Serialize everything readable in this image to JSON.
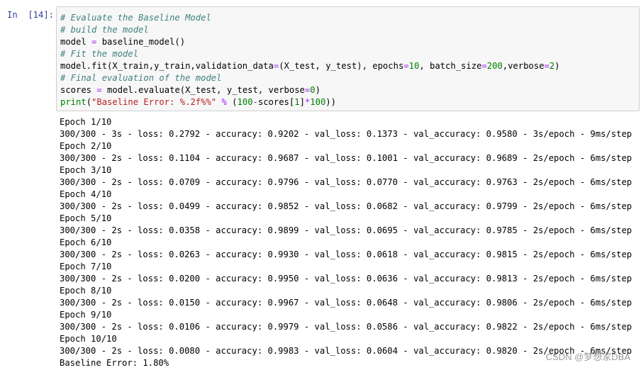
{
  "cell": {
    "prompt": "In  [14]:",
    "code_lines": [
      [
        {
          "t": "comment",
          "v": "# Evaluate the Baseline Model"
        }
      ],
      [
        {
          "t": "comment",
          "v": "# build the model"
        }
      ],
      [
        {
          "t": "plain",
          "v": "model "
        },
        {
          "t": "op",
          "v": "="
        },
        {
          "t": "plain",
          "v": " baseline_model()"
        }
      ],
      [
        {
          "t": "comment",
          "v": "# Fit the model"
        }
      ],
      [
        {
          "t": "plain",
          "v": "model.fit(X_train,y_train,validation_data"
        },
        {
          "t": "op",
          "v": "="
        },
        {
          "t": "plain",
          "v": "(X_test, y_test), epochs"
        },
        {
          "t": "op",
          "v": "="
        },
        {
          "t": "num",
          "v": "10"
        },
        {
          "t": "plain",
          "v": ", batch_size"
        },
        {
          "t": "op",
          "v": "="
        },
        {
          "t": "num",
          "v": "200"
        },
        {
          "t": "plain",
          "v": ",verbose"
        },
        {
          "t": "op",
          "v": "="
        },
        {
          "t": "num",
          "v": "2"
        },
        {
          "t": "plain",
          "v": ")"
        }
      ],
      [
        {
          "t": "comment",
          "v": "# Final evaluation of the model"
        }
      ],
      [
        {
          "t": "plain",
          "v": "scores "
        },
        {
          "t": "op",
          "v": "="
        },
        {
          "t": "plain",
          "v": " model.evaluate(X_test, y_test, verbose"
        },
        {
          "t": "op",
          "v": "="
        },
        {
          "t": "num",
          "v": "0"
        },
        {
          "t": "plain",
          "v": ")"
        }
      ],
      [
        {
          "t": "builtin",
          "v": "print"
        },
        {
          "t": "plain",
          "v": "("
        },
        {
          "t": "str",
          "v": "\"Baseline Error: %.2f%%\""
        },
        {
          "t": "plain",
          "v": " "
        },
        {
          "t": "op",
          "v": "%"
        },
        {
          "t": "plain",
          "v": " ("
        },
        {
          "t": "num",
          "v": "100"
        },
        {
          "t": "op",
          "v": "-"
        },
        {
          "t": "plain",
          "v": "scores["
        },
        {
          "t": "num",
          "v": "1"
        },
        {
          "t": "plain",
          "v": "]"
        },
        {
          "t": "op",
          "v": "*"
        },
        {
          "t": "num",
          "v": "100"
        },
        {
          "t": "plain",
          "v": "))"
        }
      ]
    ]
  },
  "output_lines": [
    "Epoch 1/10",
    "300/300 - 3s - loss: 0.2792 - accuracy: 0.9202 - val_loss: 0.1373 - val_accuracy: 0.9580 - 3s/epoch - 9ms/step",
    "Epoch 2/10",
    "300/300 - 2s - loss: 0.1104 - accuracy: 0.9687 - val_loss: 0.1001 - val_accuracy: 0.9689 - 2s/epoch - 6ms/step",
    "Epoch 3/10",
    "300/300 - 2s - loss: 0.0709 - accuracy: 0.9796 - val_loss: 0.0770 - val_accuracy: 0.9763 - 2s/epoch - 6ms/step",
    "Epoch 4/10",
    "300/300 - 2s - loss: 0.0499 - accuracy: 0.9852 - val_loss: 0.0682 - val_accuracy: 0.9799 - 2s/epoch - 6ms/step",
    "Epoch 5/10",
    "300/300 - 2s - loss: 0.0358 - accuracy: 0.9899 - val_loss: 0.0695 - val_accuracy: 0.9785 - 2s/epoch - 6ms/step",
    "Epoch 6/10",
    "300/300 - 2s - loss: 0.0263 - accuracy: 0.9930 - val_loss: 0.0618 - val_accuracy: 0.9815 - 2s/epoch - 6ms/step",
    "Epoch 7/10",
    "300/300 - 2s - loss: 0.0200 - accuracy: 0.9950 - val_loss: 0.0636 - val_accuracy: 0.9813 - 2s/epoch - 6ms/step",
    "Epoch 8/10",
    "300/300 - 2s - loss: 0.0150 - accuracy: 0.9967 - val_loss: 0.0648 - val_accuracy: 0.9806 - 2s/epoch - 6ms/step",
    "Epoch 9/10",
    "300/300 - 2s - loss: 0.0106 - accuracy: 0.9979 - val_loss: 0.0586 - val_accuracy: 0.9822 - 2s/epoch - 6ms/step",
    "Epoch 10/10",
    "300/300 - 2s - loss: 0.0080 - accuracy: 0.9983 - val_loss: 0.0604 - val_accuracy: 0.9820 - 2s/epoch - 6ms/step",
    "Baseline Error: 1.80%"
  ],
  "watermark": "CSDN @梦想家DBA",
  "colors": {
    "prompt": "#303f9f",
    "cell_background": "#f7f7f7",
    "cell_border": "#cfcfcf",
    "comment": "#408080",
    "string": "#ba2121",
    "number": "#008000",
    "operator": "#aa22ff"
  }
}
